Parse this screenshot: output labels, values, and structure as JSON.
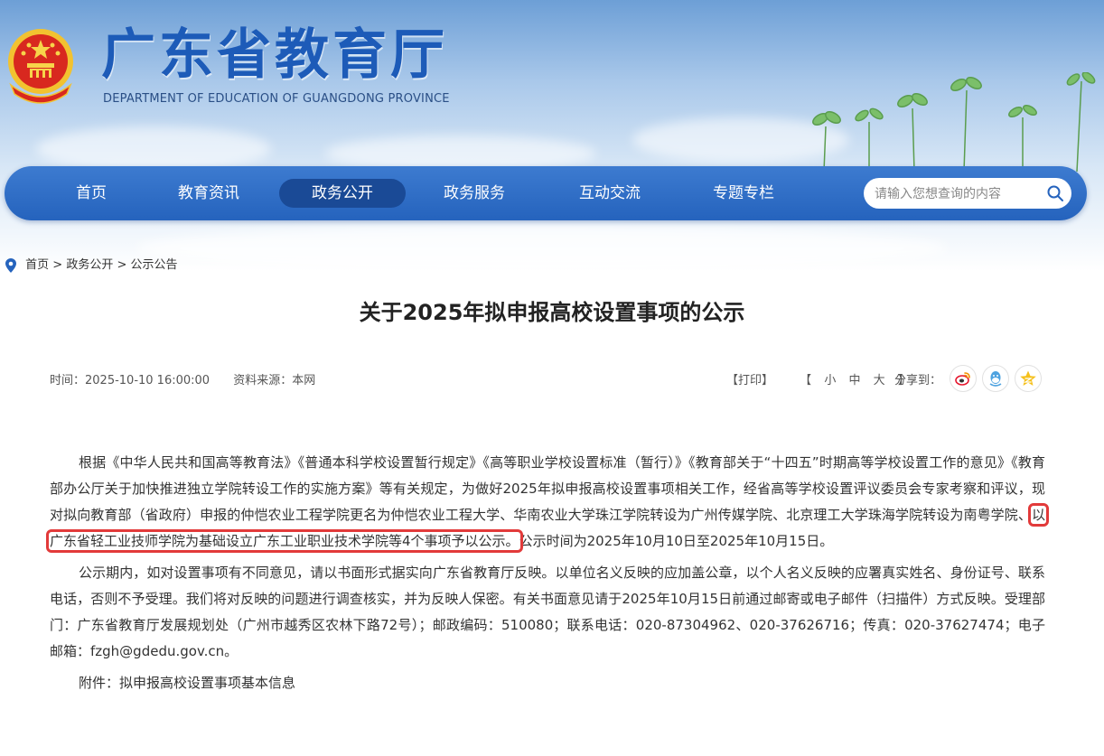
{
  "header": {
    "title": "广东省教育厅",
    "subtitle": "DEPARTMENT OF EDUCATION OF GUANGDONG PROVINCE"
  },
  "nav": {
    "items": [
      {
        "label": "首页"
      },
      {
        "label": "教育资讯"
      },
      {
        "label": "政务公开"
      },
      {
        "label": "政务服务"
      },
      {
        "label": "互动交流"
      },
      {
        "label": "专题专栏"
      }
    ],
    "active_index": 2,
    "search_placeholder": "请输入您想查询的内容"
  },
  "breadcrumb": {
    "items": [
      "首页",
      "政务公开",
      "公示公告"
    ],
    "separator": ">"
  },
  "article": {
    "title": "关于2025年拟申报高校设置事项的公示",
    "time": "时间：2025-10-10 16:00:00",
    "source": "资料来源：本网",
    "print_label": "【打印】",
    "size_open": "【",
    "size_small": "小",
    "size_medium": "中",
    "size_large": "大",
    "size_close": "】",
    "share_label": "分享到：",
    "p1_a": "根据《中华人民共和国高等教育法》《普通本科学校设置暂行规定》《高等职业学校设置标准（暂行）》《教育部关于“十四五”时期高等学校设置工作的意见》《教育部办公厅关于加快推进独立学院转设工作的实施方案》等有关规定，为做好2025年拟申报高校设置事项相关工作，经省高等学校设置评议委员会专家考察和评议，现对拟向教育部（省政府）申报的仲恺农业工程学院更名为仲恺农业工程大学、华南农业大学珠江学院转设为广州传媒学院、北京理工大学珠海学院转设为南粤学院、",
    "p1_highlight": "以广东省轻工业技师学院为基础设立广东工业职业技术学院等4个事项予以公示。",
    "p1_b": "公示时间为2025年10月10日至2025年10月15日。",
    "p2": "公示期内，如对设置事项有不同意见，请以书面形式据实向广东省教育厅反映。以单位名义反映的应加盖公章，以个人名义反映的应署真实姓名、身份证号、联系电话，否则不予受理。我们将对反映的问题进行调查核实，并为反映人保密。有关书面意见请于2025年10月15日前通过邮寄或电子邮件（扫描件）方式反映。受理部门：广东省教育厅发展规划处（广州市越秀区农林下路72号）；邮政编码：510080；联系电话：020-87304962、020-37626716；传真：020-37627474；电子邮箱：fzgh@gdedu.gov.cn。",
    "attachment": "附件：拟申报高校设置事项基本信息"
  },
  "colors": {
    "nav_bg": "#2563bd",
    "nav_active": "#1a4a96",
    "title_blue": "#1d5bb8",
    "highlight_red": "#e23a3a"
  },
  "icons": {
    "emblem": "national-emblem-icon",
    "search": "search-icon",
    "location": "location-pin-icon",
    "share": [
      "weibo-icon",
      "qq-icon",
      "qzone-icon"
    ]
  }
}
